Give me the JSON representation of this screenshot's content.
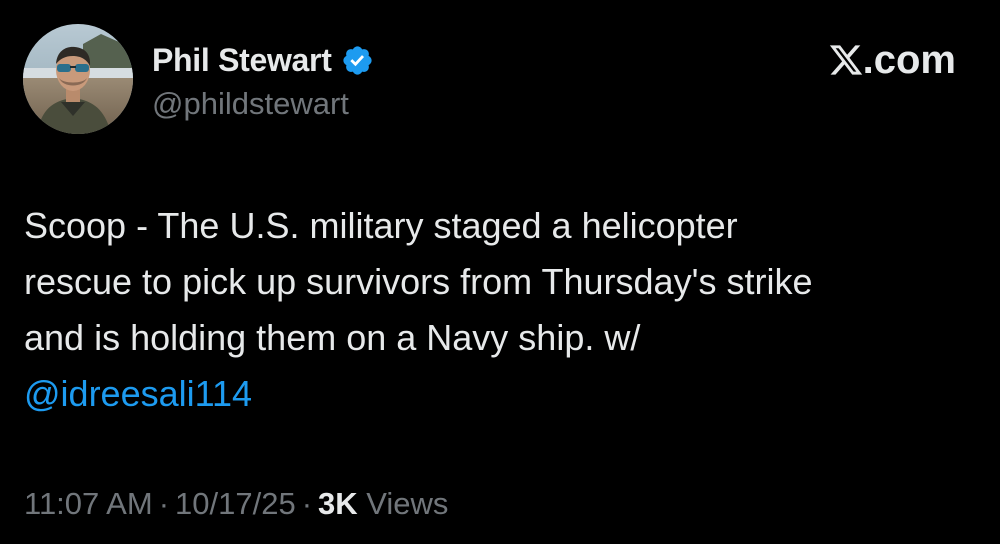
{
  "author": {
    "display_name": "Phil Stewart",
    "handle": "@phildstewart",
    "verified": true,
    "avatar_icon": "profile-photo-icon"
  },
  "brand": {
    "icon": "x-logo-icon",
    "domain": ".com"
  },
  "tweet": {
    "lines": [
      "Scoop - The U.S. military staged a helicopter",
      "rescue to pick up survivors from Thursday's strike",
      "and is holding them on a Navy ship. w/"
    ],
    "mention": "@idreesali114"
  },
  "meta": {
    "time": "11:07 AM",
    "separator": "·",
    "date": "10/17/25",
    "views_count": "3K",
    "views_label": "Views"
  },
  "colors": {
    "background": "#000000",
    "text_primary": "#e7e9ea",
    "text_secondary": "#71767b",
    "link": "#1d9bf0",
    "verified_badge": "#1d9bf0"
  }
}
